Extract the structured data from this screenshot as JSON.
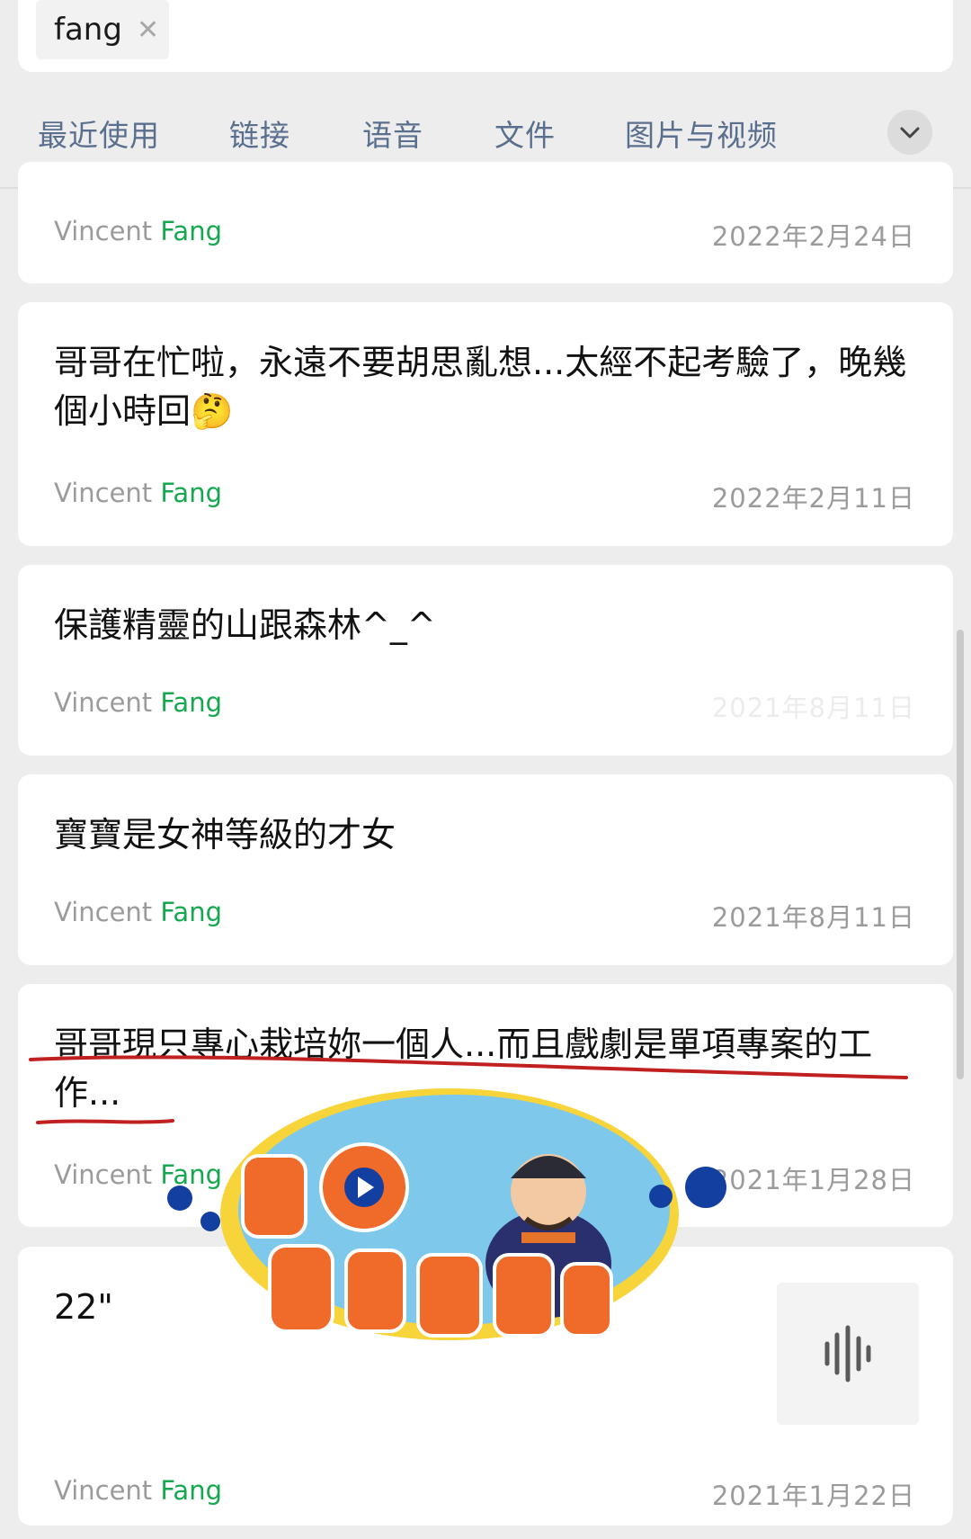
{
  "search": {
    "chip_label": "fang",
    "chip_close": "✕"
  },
  "tabs": [
    "最近使用",
    "链接",
    "语音",
    "文件",
    "图片与视频"
  ],
  "cards": [
    {
      "message": "",
      "sender_first": "Vincent",
      "sender_last": "Fang",
      "date": "2022年2月24日"
    },
    {
      "message": "哥哥在忙啦，永遠不要胡思亂想...太經不起考驗了，晚幾個小時回🤔",
      "sender_first": "Vincent",
      "sender_last": "Fang",
      "date": "2022年2月11日"
    },
    {
      "message": "保護精靈的山跟森林^_^",
      "sender_first": "Vincent",
      "sender_last": "Fang",
      "date": "2021年8月11日",
      "date_faint": true
    },
    {
      "message": "寶寶是女神等級的才女",
      "sender_first": "Vincent",
      "sender_last": "Fang",
      "date": "2021年8月11日"
    },
    {
      "message": "哥哥現只專心栽培妳一個人...而且戲劇是單項專案的工作...",
      "sender_first": "Vincent",
      "sender_last": "Fang",
      "date": "2021年1月28日"
    },
    {
      "message": "22\"",
      "sender_first": "Vincent",
      "sender_last": "Fang",
      "date": "2021年1月22日"
    }
  ],
  "icons": {
    "more": "chevron-down-icon",
    "voice": "voice-wave-icon"
  },
  "colors": {
    "highlight": "#15a84f",
    "tab": "#5a6f8e",
    "annotation": "#c0201f"
  }
}
